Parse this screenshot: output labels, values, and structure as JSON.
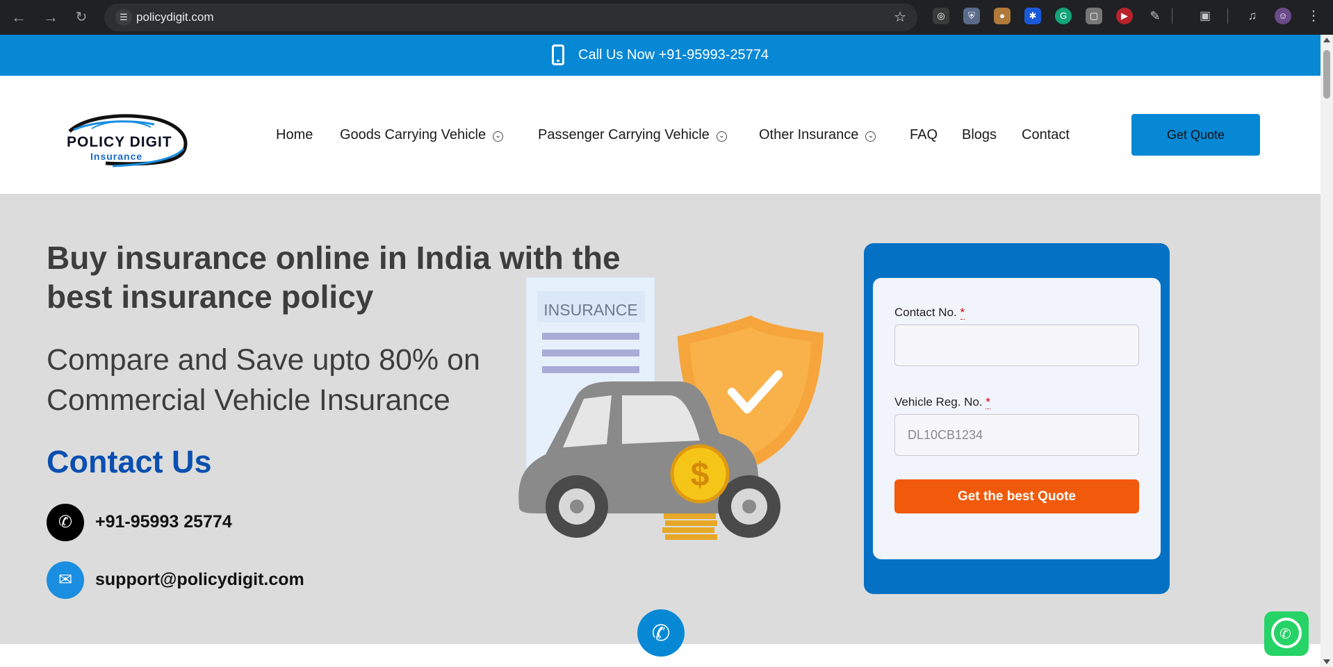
{
  "browser": {
    "url": "policydigit.com"
  },
  "callbar": {
    "text": "Call Us Now +91-95993-25774"
  },
  "header": {
    "logo_line1": "POLICY DIGIT",
    "logo_line2": "Insurance",
    "menu": [
      {
        "label": "Home"
      },
      {
        "label": "Goods Carrying Vehicle"
      },
      {
        "label": "Passenger Carrying Vehicle"
      },
      {
        "label": "Other Insurance"
      },
      {
        "label": "FAQ"
      },
      {
        "label": "Blogs"
      },
      {
        "label": "Contact"
      }
    ],
    "cta_label": "Get Quote"
  },
  "hero": {
    "headline": "Buy insurance online in India with the best insurance policy",
    "subline": "Compare and Save upto 80% on Commercial Vehicle Insurance",
    "contact_title": "Contact Us",
    "phone": "+91-95993 25774",
    "email": "support@policydigit.com",
    "illustration_label": "INSURANCE"
  },
  "form": {
    "contact_label": "Contact No.",
    "contact_value": "",
    "vehicle_label": "Vehicle Reg. No.",
    "vehicle_placeholder": "DL10CB1234",
    "required_mark": "*",
    "submit_label": "Get the best Quote"
  },
  "colors": {
    "brand_blue": "#0788d5",
    "form_blue": "#0571c4",
    "submit_orange": "#f15a0a",
    "headline_text": "#3d3d3d",
    "contact_title": "#0a4fb0",
    "hero_bg": "#dcdcdc",
    "whatsapp_green": "#25d366"
  }
}
